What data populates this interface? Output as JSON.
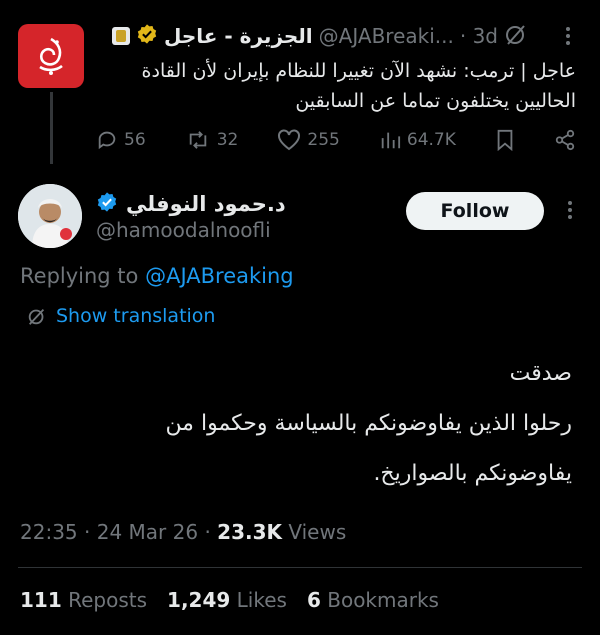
{
  "parent": {
    "name": "الجزيرة - عاجل",
    "handle": "@AJABreaki...",
    "time": "· 3d",
    "logo_text": "الجزيرة",
    "body_line1": "عاجل | ترمب: نشهد الآن تغييرا للنظام بإيران لأن القادة",
    "body_line2": "الحاليين يختلفون تماما عن السابقين",
    "replies": "56",
    "reposts": "32",
    "likes": "255",
    "views": "64.7K",
    "brand_color": "#d5252a"
  },
  "tweet": {
    "name": "د.حمود النوفلي",
    "handle": "@hamoodalnoofli",
    "follow_label": "Follow",
    "replying_prefix": "Replying to ",
    "replying_handle": "@AJABreaking",
    "show_translation": "Show translation",
    "body_line1": "صدقت",
    "body_line2": "رحلوا الذين يفاوضونكم بالسياسة وحكموا من",
    "body_line3": "يفاوضونكم بالصواريخ.",
    "time": "22:35",
    "date": "24 Mar 26",
    "views_count": "23.3K",
    "views_label": "Views",
    "reposts_count": "111",
    "reposts_label": "Reposts",
    "likes_count": "1,249",
    "likes_label": "Likes",
    "bookmarks_count": "6",
    "bookmarks_label": "Bookmarks"
  },
  "colors": {
    "background": "#000000",
    "text": "#e7e9ea",
    "muted": "#71767b",
    "accent": "#1d9bf0"
  }
}
